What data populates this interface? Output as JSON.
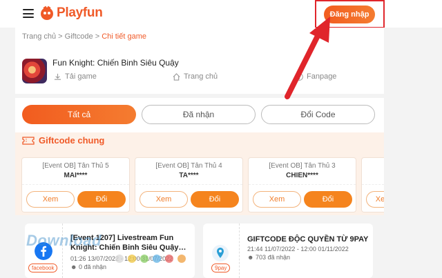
{
  "header": {
    "brand": "Playfun",
    "login_label": "Đăng nhập"
  },
  "breadcrumb": {
    "home": "Trang chủ",
    "sep1": " > ",
    "giftcode": "Giftcode",
    "sep2": " > ",
    "current": "Chi tiết game"
  },
  "game": {
    "title": "Fun Knight: Chiến Binh Siêu Quậy",
    "links": [
      "Tải game",
      "Trang chủ",
      "Fanpage"
    ]
  },
  "tabs": [
    "Tất cả",
    "Đã nhận",
    "Đổi Code"
  ],
  "section": {
    "title": "Giftcode chung"
  },
  "cards": [
    {
      "event": "[Event OB] Tân Thủ 5",
      "code": "MAI****",
      "view": "Xem",
      "swap": "Đổi"
    },
    {
      "event": "[Event OB] Tân Thủ 4",
      "code": "TA****",
      "view": "Xem",
      "swap": "Đổi"
    },
    {
      "event": "[Event OB] Tân Thủ 3",
      "code": "CHIEN****",
      "view": "Xem",
      "swap": "Đổi"
    },
    {
      "event": "",
      "code": "",
      "view": "Xe",
      "swap": ""
    }
  ],
  "events": [
    {
      "tag": "facebook",
      "title": "[Event 1207] Livestream Fun Knight: Chiến Binh Siêu Quậy…",
      "time": "01:26 13/07/2022 - 12:00 31/07/2022",
      "count": "0 đã nhận"
    },
    {
      "tag": "9pay",
      "title": "GIFTCODE ĐỘC QUYỀN TỪ 9PAY",
      "time": "21:44 11/07/2022 - 12:00 01/11/2022",
      "count": "703 đã nhận"
    }
  ],
  "colors": {
    "brand": "#f05a28",
    "accent": "#f5841e",
    "highlight": "#e0252b",
    "section_bg": "#fdf1e8"
  }
}
